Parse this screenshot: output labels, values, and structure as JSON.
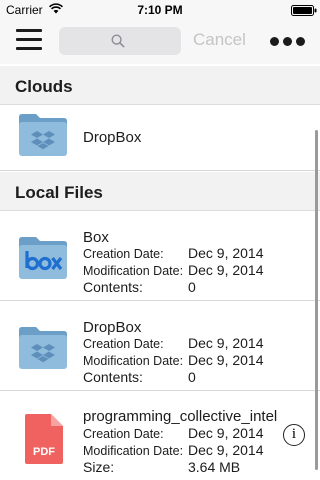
{
  "status_bar": {
    "carrier": "Carrier",
    "time": "7:10 PM"
  },
  "nav": {
    "search_placeholder": "",
    "cancel_label": "Cancel"
  },
  "sections": {
    "clouds": {
      "title": "Clouds",
      "items": [
        {
          "name": "DropBox",
          "icon": "dropbox-folder-icon"
        }
      ]
    },
    "local": {
      "title": "Local Files",
      "items": [
        {
          "name": "Box",
          "icon": "box-folder-icon",
          "creation_label": "Creation Date:",
          "creation": "Dec 9, 2014",
          "modification_label": "Modification Date:",
          "modification": "Dec 9, 2014",
          "extra_label": "Contents:",
          "extra": "0"
        },
        {
          "name": "DropBox",
          "icon": "dropbox-folder-icon",
          "creation_label": "Creation Date:",
          "creation": "Dec 9, 2014",
          "modification_label": "Modification Date:",
          "modification": "Dec 9, 2014",
          "extra_label": "Contents:",
          "extra": "0"
        },
        {
          "name": "programming_collective_intel",
          "icon": "pdf-file-icon",
          "badge": "PDF",
          "creation_label": "Creation Date:",
          "creation": "Dec 9, 2014",
          "modification_label": "Modification Date:",
          "modification": "Dec 9, 2014",
          "extra_label": "Size:",
          "extra": "3.64 MB"
        }
      ]
    }
  },
  "colors": {
    "folder": "#8fbbdc",
    "folder_dark": "#6c9fc8",
    "pdf": "#f0625f",
    "box_blue": "#1e6fd0"
  },
  "info_glyph": "i"
}
